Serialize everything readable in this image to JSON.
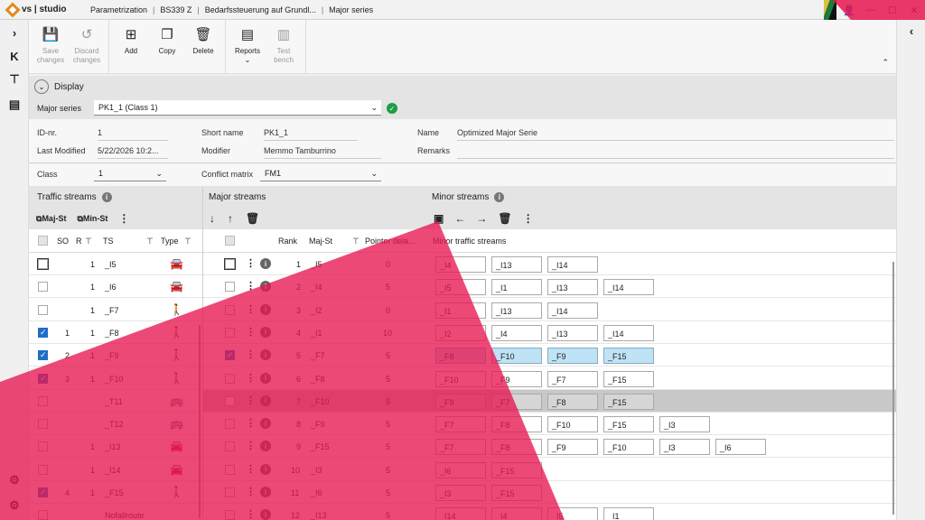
{
  "titlebar": {
    "app": "vs | studio",
    "crumbs": [
      "Parametrization",
      "BS339 Z",
      "Bedarfssteuerung auf Grundl...",
      "Major series"
    ]
  },
  "toolbar": {
    "buttons": [
      {
        "label": "Save\nchanges",
        "icon": "save-icon",
        "disabled": true
      },
      {
        "label": "Discard\nchanges",
        "icon": "undo-icon",
        "disabled": true
      },
      {
        "label": "Add",
        "icon": "add-icon",
        "disabled": false
      },
      {
        "label": "Copy",
        "icon": "copy-icon",
        "disabled": false
      },
      {
        "label": "Delete",
        "icon": "trash-icon",
        "disabled": false
      },
      {
        "label": "Reports",
        "icon": "report-icon",
        "disabled": false
      },
      {
        "label": "Test\nbench",
        "icon": "testbench-icon",
        "disabled": true
      }
    ]
  },
  "display": {
    "section_label": "Display",
    "major_series_label": "Major series",
    "major_series_value": "PK1_1 (Class 1)"
  },
  "form": {
    "id_label": "ID-nr.",
    "id_value": "1",
    "modified_label": "Last Modified",
    "modified_value": "5/22/2026 10:2...",
    "short_label": "Short name",
    "short_value": "PK1_1",
    "modifier_label": "Modifier",
    "modifier_value": "Memmo Tamburrino",
    "name_label": "Name",
    "name_value": "Optimized Major Serie",
    "remarks_label": "Remarks",
    "remarks_value": "",
    "class_label": "Class",
    "class_value": "1",
    "conflict_label": "Conflict matrix",
    "conflict_value": "FM1"
  },
  "traffic_streams": {
    "title": "Traffic streams",
    "maj_label": "Maj-St",
    "min_label": "Min-St",
    "headers": {
      "so": "SO",
      "r": "R",
      "ts": "TS",
      "type": "Type"
    },
    "rows": [
      {
        "checked": false,
        "so": "",
        "r": "1",
        "ts": "_I5",
        "type": "car"
      },
      {
        "checked": false,
        "so": "",
        "r": "1",
        "ts": "_I6",
        "type": "car"
      },
      {
        "checked": false,
        "so": "",
        "r": "1",
        "ts": "_F7",
        "type": "ped"
      },
      {
        "checked": true,
        "so": "1",
        "r": "1",
        "ts": "_F8",
        "type": "ped"
      },
      {
        "checked": true,
        "so": "2",
        "r": "1",
        "ts": "_F9",
        "type": "ped"
      },
      {
        "checked": true,
        "so": "3",
        "r": "1",
        "ts": "_F10",
        "type": "ped"
      },
      {
        "checked": false,
        "so": "",
        "r": "",
        "ts": "_T11",
        "type": "bus"
      },
      {
        "checked": false,
        "so": "",
        "r": "",
        "ts": "_T12",
        "type": "bus"
      },
      {
        "checked": false,
        "so": "",
        "r": "1",
        "ts": "_I13",
        "type": "car"
      },
      {
        "checked": false,
        "so": "",
        "r": "1",
        "ts": "_I14",
        "type": "car"
      },
      {
        "checked": true,
        "so": "4",
        "r": "1",
        "ts": "_F15",
        "type": "ped"
      },
      {
        "checked": false,
        "so": "",
        "r": "",
        "ts": "Nofallroute",
        "type": ""
      }
    ]
  },
  "major_streams": {
    "title": "Major streams",
    "headers": {
      "rank": "Rank",
      "majst": "Maj-St",
      "pointer": "Pointer dela..."
    },
    "rows": [
      {
        "checked": false,
        "rank": "1",
        "majst": "_I5",
        "pointer": "0",
        "minor": [
          "_I4",
          "_I13",
          "_I14"
        ],
        "sel": false,
        "hl": false
      },
      {
        "checked": false,
        "rank": "2",
        "majst": "_I4",
        "pointer": "5",
        "minor": [
          "_I5",
          "_I1",
          "_I13",
          "_I14"
        ],
        "sel": false,
        "hl": false
      },
      {
        "checked": false,
        "rank": "3",
        "majst": "_I2",
        "pointer": "0",
        "minor": [
          "_I1",
          "_I13",
          "_I14"
        ],
        "sel": false,
        "hl": false
      },
      {
        "checked": false,
        "rank": "4",
        "majst": "_I1",
        "pointer": "10",
        "minor": [
          "_I2",
          "_I4",
          "_I13",
          "_I14"
        ],
        "sel": false,
        "hl": false
      },
      {
        "checked": true,
        "rank": "5",
        "majst": "_F7",
        "pointer": "5",
        "minor": [
          "_F8",
          "_F10",
          "_F9",
          "_F15"
        ],
        "sel": false,
        "hl": true
      },
      {
        "checked": false,
        "rank": "6",
        "majst": "_F8",
        "pointer": "5",
        "minor": [
          "_F10",
          "_F9",
          "_F7",
          "_F15"
        ],
        "sel": false,
        "hl": false
      },
      {
        "checked": false,
        "rank": "7",
        "majst": "_F10",
        "pointer": "5",
        "minor": [
          "_F9",
          "_F7",
          "_F8",
          "_F15"
        ],
        "sel": true,
        "hl": false
      },
      {
        "checked": false,
        "rank": "8",
        "majst": "_F9",
        "pointer": "5",
        "minor": [
          "_F7",
          "_F8",
          "_F10",
          "_F15",
          "_I3"
        ],
        "sel": false,
        "hl": false
      },
      {
        "checked": false,
        "rank": "9",
        "majst": "_F15",
        "pointer": "5",
        "minor": [
          "_F7",
          "_F8",
          "_F9",
          "_F10",
          "_I3",
          "_I6"
        ],
        "sel": false,
        "hl": false
      },
      {
        "checked": false,
        "rank": "10",
        "majst": "_I3",
        "pointer": "5",
        "minor": [
          "_I6",
          "_F15"
        ],
        "sel": false,
        "hl": false
      },
      {
        "checked": false,
        "rank": "11",
        "majst": "_I6",
        "pointer": "5",
        "minor": [
          "_I3",
          "_F15"
        ],
        "sel": false,
        "hl": false
      },
      {
        "checked": false,
        "rank": "12",
        "majst": "_I13",
        "pointer": "5",
        "minor": [
          "_I14",
          "_I4",
          "_I5",
          "_I1"
        ],
        "sel": false,
        "hl": false
      }
    ]
  },
  "minor_streams": {
    "title": "Minor streams",
    "col_header": "Minor traffic streams"
  },
  "colors": {
    "accent_overlay": "#e8164f",
    "check": "#1f6fc5",
    "ok": "#1e9c47"
  }
}
